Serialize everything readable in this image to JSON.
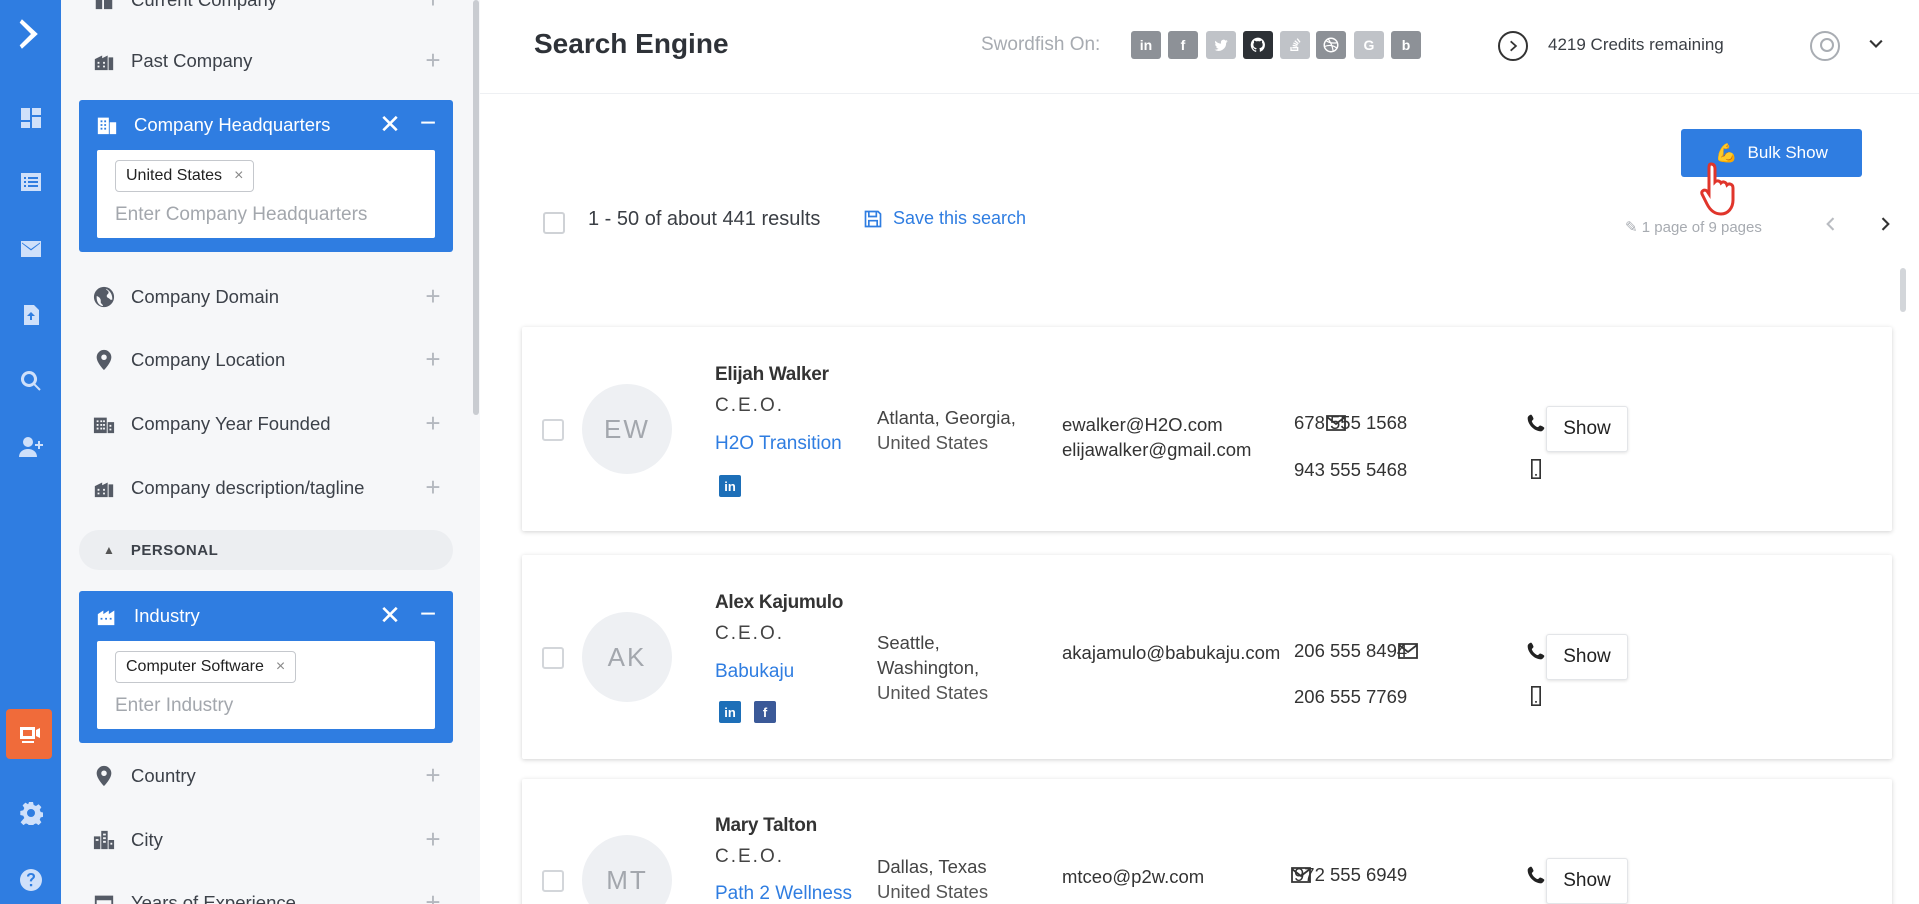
{
  "rail": {
    "icons": [
      "chevron-logo-icon",
      "dashboard-icon",
      "list-icon",
      "mail-icon",
      "document-upload-icon",
      "search-icon",
      "add-user-icon",
      "video-icon",
      "settings-icon",
      "help-icon"
    ],
    "accent": "#2f7de1",
    "active_color": "#f06b3a"
  },
  "filters": {
    "top_cut_label": "Current Company",
    "past_company": "Past Company",
    "hq": {
      "label": "Company Headquarters",
      "chip": "United States",
      "placeholder": "Enter Company Headquarters"
    },
    "domain": "Company Domain",
    "location": "Company Location",
    "year_founded": "Company Year Founded",
    "description": "Company description/tagline",
    "section_personal": "PERSONAL",
    "industry": {
      "label": "Industry",
      "chip": "Computer Software",
      "placeholder": "Enter Industry"
    },
    "country": "Country",
    "city": "City",
    "years_experience": "Years of Experience"
  },
  "header": {
    "title": "Search Engine",
    "swordfish_label": "Swordfish On:",
    "socials": [
      "in",
      "f",
      "t",
      "gh",
      "so",
      "dr",
      "G",
      "b"
    ],
    "credits": "4219 Credits remaining"
  },
  "toolbar": {
    "bulk_show": "Bulk Show",
    "results_count": "1  - 50 of about 441 results",
    "save_search": "Save this search",
    "pager_text": "1 page of 9 pages"
  },
  "results": [
    {
      "initials": "EW",
      "name": "Elijah Walker",
      "title": "C.E.O.",
      "company": "H2O Transition",
      "location_line1": "Atlanta, Georgia,",
      "location_line2": "United States",
      "email1": "ewalker@H2O.com",
      "email2": "elijawalker@gmail.com",
      "phone1": "678 555 1568",
      "phone2": "943 555 5468",
      "show": "Show"
    },
    {
      "initials": "AK",
      "name": "Alex Kajumulo",
      "title": "C.E.O.",
      "company": "Babukaju",
      "location_line1": "Seattle,",
      "location_line2": "Washington,",
      "location_line3": "United States",
      "email1": "akajamulo@babukaju.com",
      "phone1": "206 555 8494",
      "phone2": "206 555 7769",
      "show": "Show"
    },
    {
      "initials": "MT",
      "name": "Mary Talton",
      "title": "C.E.O.",
      "company": "Path 2 Wellness",
      "location_line1": "Dallas, Texas",
      "location_line2": "United States",
      "email1": "mtceo@p2w.com",
      "phone1": "972 555 6949",
      "show": "Show"
    }
  ]
}
